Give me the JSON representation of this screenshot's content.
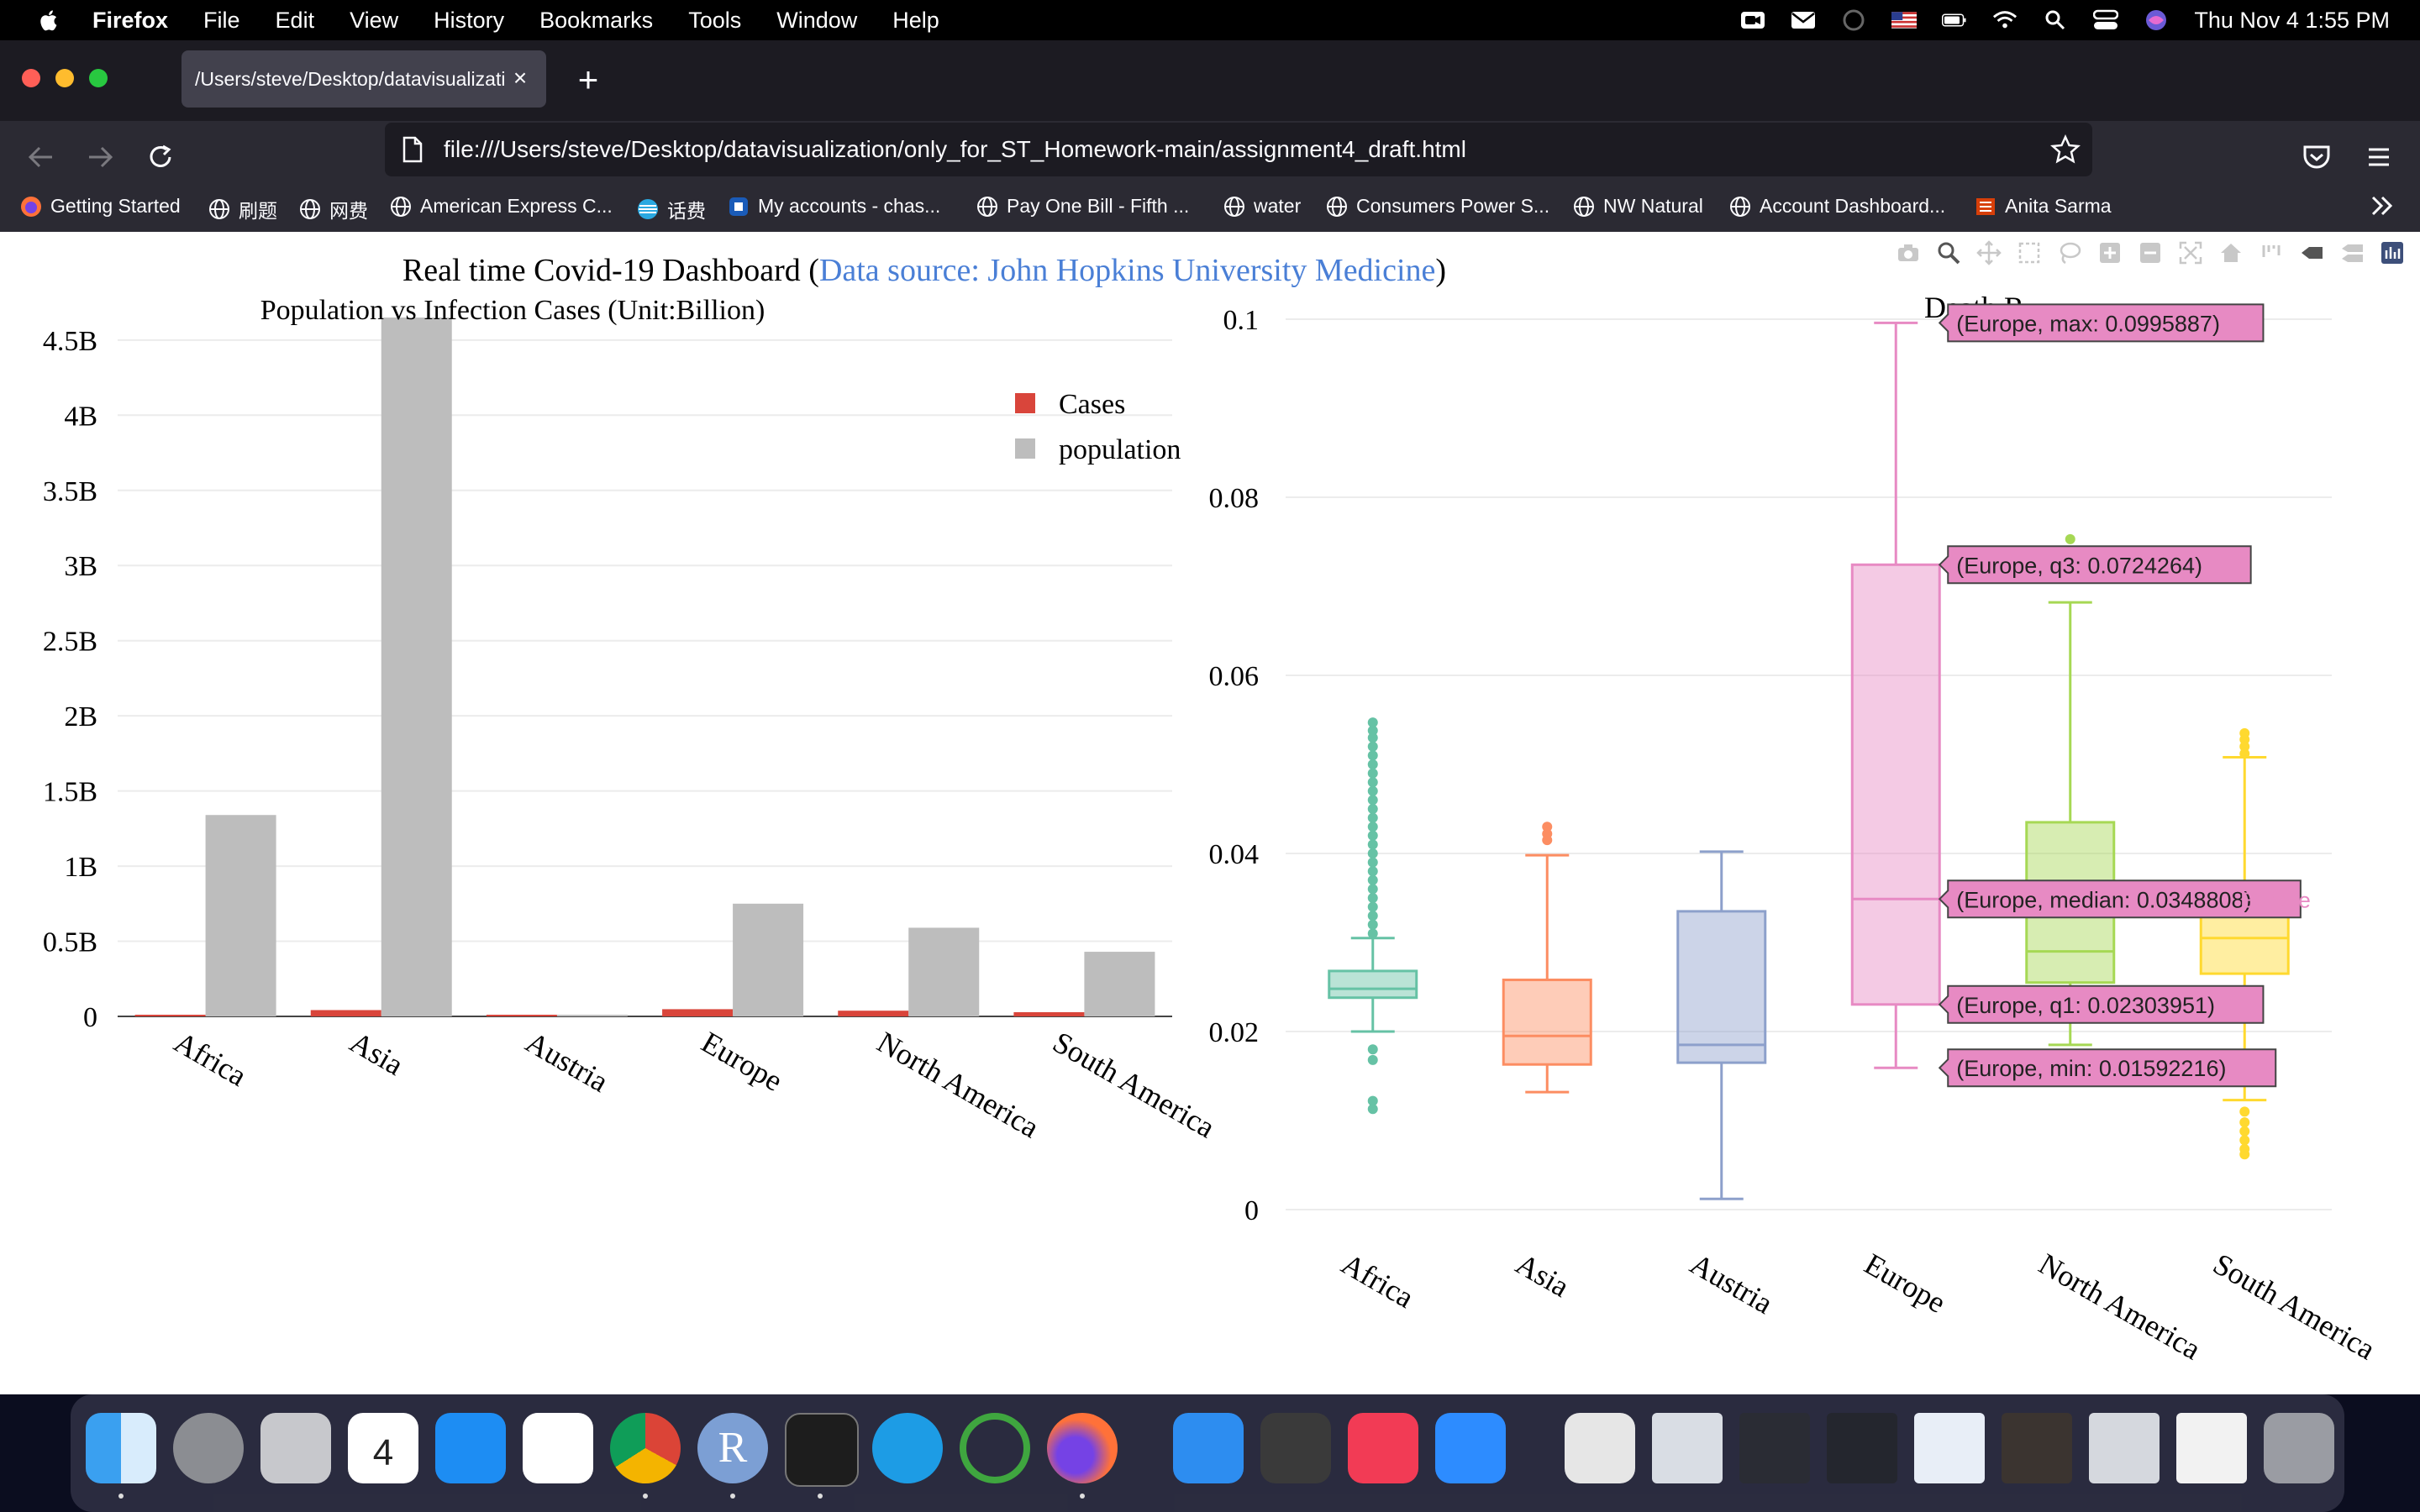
{
  "menubar": {
    "app_name": "Firefox",
    "menus": [
      "File",
      "Edit",
      "View",
      "History",
      "Bookmarks",
      "Tools",
      "Window",
      "Help"
    ],
    "clock": "Thu Nov 4  1:55 PM"
  },
  "browser": {
    "tab_title": "/Users/steve/Desktop/datavisualizati",
    "url": "file:///Users/steve/Desktop/datavisualization/only_for_ST_Homework-main/assignment4_draft.html",
    "bookmarks": [
      "Getting Started",
      "刷题",
      "网费",
      "American Express C...",
      "话费",
      "My accounts - chas...",
      "Pay One Bill - Fifth ...",
      "water",
      "Consumers Power S...",
      "NW Natural",
      "Account Dashboard...",
      "Anita Sarma"
    ]
  },
  "dashboard": {
    "title_main": "Real time Covid-19 Dashboard (",
    "title_link": "Data source: John Hopkins University Medicine",
    "title_close": ")"
  },
  "chart_data": [
    {
      "type": "bar",
      "title": "Population vs Infection Cases (Unit:Billion)",
      "categories": [
        "Africa",
        "Asia",
        "Austria",
        "Europe",
        "North America",
        "South America"
      ],
      "series": [
        {
          "name": "Cases",
          "color": "#d9453b",
          "values": [
            0.0085,
            0.042,
            0.0012,
            0.048,
            0.038,
            0.028
          ]
        },
        {
          "name": "population",
          "color": "#bdbdbd",
          "values": [
            1.34,
            4.65,
            0.009,
            0.75,
            0.59,
            0.43
          ]
        }
      ],
      "ylim": [
        0,
        4.65
      ],
      "yticks": [
        0,
        0.5,
        1,
        1.5,
        2,
        2.5,
        3,
        3.5,
        4,
        4.5
      ],
      "ytick_labels": [
        "0",
        "0.5B",
        "1B",
        "1.5B",
        "2B",
        "2.5B",
        "3B",
        "3.5B",
        "4B",
        "4.5B"
      ],
      "legend": "top-right",
      "grid": true
    },
    {
      "type": "box",
      "title": "Death R",
      "categories": [
        "Africa",
        "Asia",
        "Austria",
        "Europe",
        "North America",
        "South America"
      ],
      "colors": [
        "#66c2a5",
        "#fc8d62",
        "#8da0cb",
        "#e78ac3",
        "#a6d854",
        "#ffd92f"
      ],
      "boxes": [
        {
          "min": 0.02,
          "q1": 0.0238,
          "median": 0.0248,
          "q3": 0.0268,
          "max": 0.0305,
          "outliers": [
            0.0547,
            0.0538,
            0.053,
            0.052,
            0.051,
            0.05,
            0.049,
            0.048,
            0.047,
            0.046,
            0.045,
            0.044,
            0.043,
            0.042,
            0.041,
            0.04,
            0.039,
            0.038,
            0.037,
            0.036,
            0.035,
            0.034,
            0.033,
            0.032,
            0.031,
            0.018,
            0.0168,
            0.0122,
            0.0113
          ]
        },
        {
          "min": 0.0132,
          "q1": 0.0163,
          "median": 0.0195,
          "q3": 0.0258,
          "max": 0.0398,
          "outliers": [
            0.0415,
            0.0422,
            0.043
          ]
        },
        {
          "min": 0.0012,
          "q1": 0.0165,
          "median": 0.0185,
          "q3": 0.0335,
          "max": 0.0402,
          "outliers": []
        },
        {
          "min": 0.01592216,
          "q1": 0.02303951,
          "median": 0.0348808,
          "q3": 0.0724264,
          "max": 0.0995887,
          "outliers": []
        },
        {
          "min": 0.0185,
          "q1": 0.0255,
          "median": 0.029,
          "q3": 0.0435,
          "max": 0.0682,
          "outliers": [
            0.0753
          ]
        },
        {
          "min": 0.0123,
          "q1": 0.0265,
          "median": 0.0305,
          "q3": 0.034,
          "max": 0.0508,
          "outliers": [
            0.0535,
            0.0528,
            0.052,
            0.0512,
            0.011,
            0.0098,
            0.0088,
            0.0078,
            0.0068,
            0.0062
          ]
        }
      ],
      "ylim": [
        0,
        0.1
      ],
      "yticks": [
        0,
        0.02,
        0.04,
        0.06,
        0.08,
        0.1
      ],
      "ytick_labels": [
        "0",
        "0.02",
        "0.04",
        "0.06",
        "0.08",
        "0.1"
      ],
      "hover_labels": [
        "(Europe, max: 0.0995887)",
        "(Europe, q3: 0.0724264)",
        "(Europe, median: 0.0348808)",
        "(Europe, q1: 0.02303951)",
        "(Europe, min: 0.01592216)"
      ],
      "hover_trace_name": "Europe"
    }
  ]
}
